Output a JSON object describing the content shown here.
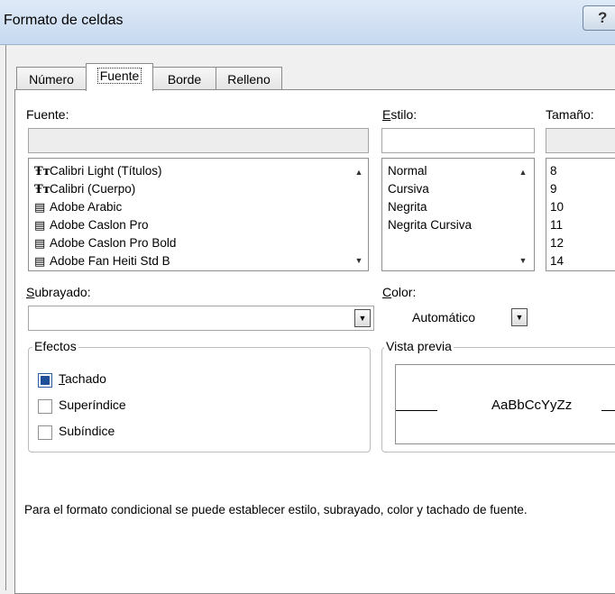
{
  "window": {
    "title": "Formato de celdas",
    "help_glyph": "?"
  },
  "tabs": [
    {
      "label": "Número"
    },
    {
      "label": "Fuente"
    },
    {
      "label": "Borde"
    },
    {
      "label": "Relleno"
    }
  ],
  "font": {
    "label": "Fuente:",
    "value": "",
    "items": [
      {
        "icon": "truetype-font-icon",
        "glyph": "Ŧᴛ",
        "name": "Calibri Light (Títulos)"
      },
      {
        "icon": "truetype-font-icon",
        "glyph": "Ŧᴛ",
        "name": "Calibri (Cuerpo)"
      },
      {
        "icon": "opentype-font-icon",
        "glyph": "▤",
        "name": "Adobe Arabic"
      },
      {
        "icon": "opentype-font-icon",
        "glyph": "▤",
        "name": "Adobe Caslon Pro"
      },
      {
        "icon": "opentype-font-icon",
        "glyph": "▤",
        "name": "Adobe Caslon Pro Bold"
      },
      {
        "icon": "opentype-font-icon",
        "glyph": "▤",
        "name": "Adobe Fan Heiti Std B"
      }
    ]
  },
  "style": {
    "label_first": "E",
    "label_rest": "stilo:",
    "value": "",
    "items": [
      "Normal",
      "Cursiva",
      "Negrita",
      "Negrita Cursiva"
    ]
  },
  "size": {
    "label": "Tamaño:",
    "value": "",
    "items": [
      "8",
      "9",
      "10",
      "11",
      "12",
      "14"
    ]
  },
  "underline": {
    "label_first": "S",
    "label_rest": "ubrayado:",
    "value": ""
  },
  "color": {
    "label_first": "C",
    "label_rest": "olor:",
    "value": "Automático"
  },
  "effects": {
    "title": "Efectos",
    "items": [
      {
        "first": "T",
        "rest": "achado",
        "checked": true
      },
      {
        "first": "",
        "rest": "Superíndice",
        "checked": false
      },
      {
        "first": "",
        "rest": "Subíndice",
        "checked": false
      }
    ]
  },
  "preview": {
    "title": "Vista previa",
    "sample": "AaBbCcYyZz"
  },
  "info_text": "Para el formato condicional se puede establecer estilo, subrayado, color y tachado de fuente."
}
